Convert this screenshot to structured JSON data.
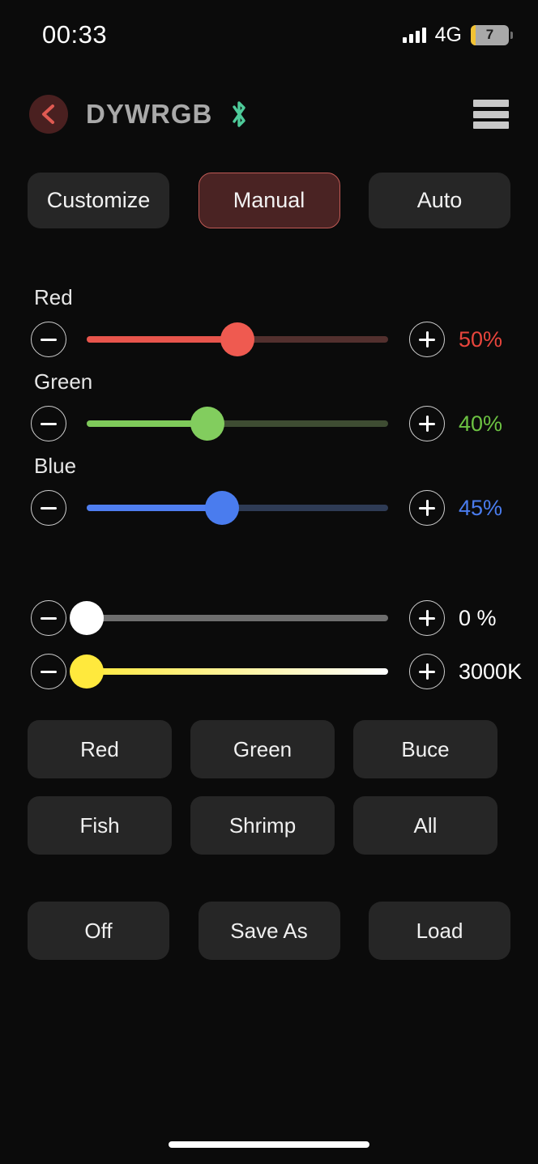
{
  "status_bar": {
    "time": "00:33",
    "network": "4G",
    "battery_level": "7",
    "signal_icon": "signal-bars-icon",
    "battery_icon": "battery-low-icon"
  },
  "header": {
    "back_icon": "chevron-left-icon",
    "title": "DYWRGB",
    "bluetooth_icon": "bluetooth-icon",
    "menu_icon": "hamburger-menu-icon",
    "back_circle_color": "#4a2020",
    "back_chevron_color": "#e05a52",
    "bluetooth_color": "#4ecb9a",
    "title_color": "#a9a9a9"
  },
  "tabs": [
    {
      "label": "Customize",
      "active": false
    },
    {
      "label": "Manual",
      "active": true
    },
    {
      "label": "Auto",
      "active": false
    }
  ],
  "tab_active_bg": "#4a2323",
  "tab_active_border": "#c05a55",
  "color_sliders": [
    {
      "label": "Red",
      "value": "50%",
      "percent": 50,
      "fill_color": "#e8554c",
      "rail_color": "#53302e",
      "thumb_color": "#ef5a50",
      "value_color": "#e8453c",
      "minus_icon": "minus-icon",
      "plus_icon": "plus-icon"
    },
    {
      "label": "Green",
      "value": "40%",
      "percent": 40,
      "fill_color": "#7ec95a",
      "rail_color": "#3e4c32",
      "thumb_color": "#82cd5e",
      "value_color": "#6cc242",
      "minus_icon": "minus-icon",
      "plus_icon": "plus-icon"
    },
    {
      "label": "Blue",
      "value": "45%",
      "percent": 45,
      "fill_color": "#4f7ef0",
      "rail_color": "#2e3b55",
      "thumb_color": "#4a7cee",
      "value_color": "#4a7cee",
      "minus_icon": "minus-icon",
      "plus_icon": "plus-icon"
    }
  ],
  "white_slider": {
    "value": "0 %",
    "percent": 0,
    "rail_color": "#6e6e6e",
    "thumb_color": "#ffffff",
    "value_color": "#ffffff",
    "minus_icon": "minus-icon",
    "plus_icon": "plus-icon"
  },
  "kelvin_slider": {
    "value": "3000K",
    "percent": 0,
    "gradient_from": "#ffe93d",
    "gradient_to": "#ffffff",
    "thumb_color": "#ffe93d",
    "value_color": "#ffffff",
    "minus_icon": "minus-icon",
    "plus_icon": "plus-icon"
  },
  "presets": [
    {
      "label": "Red"
    },
    {
      "label": "Green"
    },
    {
      "label": "Buce"
    },
    {
      "label": "Fish"
    },
    {
      "label": "Shrimp"
    },
    {
      "label": "All"
    }
  ],
  "actions": [
    {
      "label": "Off"
    },
    {
      "label": "Save As"
    },
    {
      "label": "Load"
    }
  ],
  "home_indicator": "home-indicator"
}
